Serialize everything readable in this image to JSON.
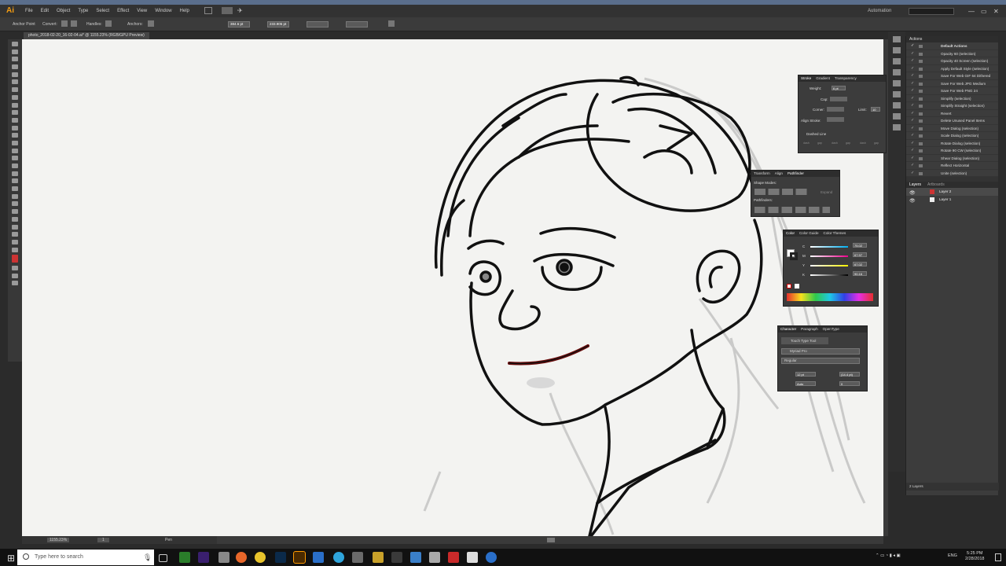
{
  "app": {
    "logo": "Ai",
    "menus": [
      "File",
      "Edit",
      "Object",
      "Type",
      "Select",
      "Effect",
      "View",
      "Window",
      "Help"
    ],
    "workspace": "Automation",
    "accent": "#f39c12"
  },
  "control_bar": {
    "tool_label": "Anchor Point",
    "convert_label": "Convert:",
    "handles_label": "Handles:",
    "anchors_label": "Anchors:",
    "x_value": "384.6 pt",
    "y_value": "233.905 pt"
  },
  "document": {
    "tab_title": "photo_2018-02-20_16-02-04.ai* @ 1155.23% (RGB/GPU Preview)"
  },
  "status": {
    "zoom": "1155.23%",
    "page": "1",
    "tool": "Pen"
  },
  "actions_panel": {
    "title": "Actions",
    "set_name": "Default Actions",
    "items": [
      "Opacity 60 (selection)",
      "Opacity 40 Screen (selection)",
      "Apply Default Style (selection)",
      "Save For Web GIF 64 Dithered",
      "Save For Web JPG Medium",
      "Save For Web PNG 24",
      "Simplify (selection)",
      "Simplify Straight (selection)",
      "Revert",
      "Delete Unused Panel Items",
      "Move Dialog (selection)",
      "Scale Dialog (selection)",
      "Rotate Dialog (selection)",
      "Rotate 90 CW (selection)",
      "Shear Dialog (selection)",
      "Reflect Horizontal",
      "Unite (selection)"
    ]
  },
  "layers_panel": {
    "tabs": [
      "Layers",
      "Artboards"
    ],
    "layers": [
      "Layer 2",
      "Layer 1"
    ],
    "footer": "2 Layers"
  },
  "stroke_panel": {
    "tabs": [
      "Stroke",
      "Gradient",
      "Transparency"
    ],
    "weight_label": "Weight:",
    "weight_value": "6 pt",
    "cap_label": "Cap:",
    "corner_label": "Corner:",
    "limit_label": "Limit:",
    "limit_value": "10",
    "align_label": "Align Stroke:",
    "dashed_label": "Dashed Line",
    "dash_labels": [
      "dash",
      "gap",
      "dash",
      "gap",
      "dash",
      "gap"
    ]
  },
  "pathfinder_panel": {
    "tabs": [
      "Transform",
      "Align",
      "Pathfinder"
    ],
    "shape_modes_label": "Shape Modes:",
    "expand_label": "Expand",
    "pathfinders_label": "Pathfinders:"
  },
  "color_panel": {
    "tabs": [
      "Color",
      "Color Guide",
      "Color Themes"
    ],
    "channels": [
      {
        "label": "C",
        "value": "75.02"
      },
      {
        "label": "M",
        "value": "67.97"
      },
      {
        "label": "Y",
        "value": "67.02"
      },
      {
        "label": "K",
        "value": "90.16"
      }
    ]
  },
  "character_panel": {
    "tabs": [
      "Character",
      "Paragraph",
      "OpenType"
    ],
    "touch_label": "Touch Type Tool",
    "font_family": "Myriad Pro",
    "font_style": "Regular",
    "font_size": "12 pt",
    "leading": "(14.4 pt)",
    "kerning": "Auto",
    "tracking": "0"
  },
  "taskbar": {
    "search_placeholder": "Type here to search",
    "lang": "ENG",
    "time": "5:25 PM",
    "date": "2/28/2018"
  }
}
